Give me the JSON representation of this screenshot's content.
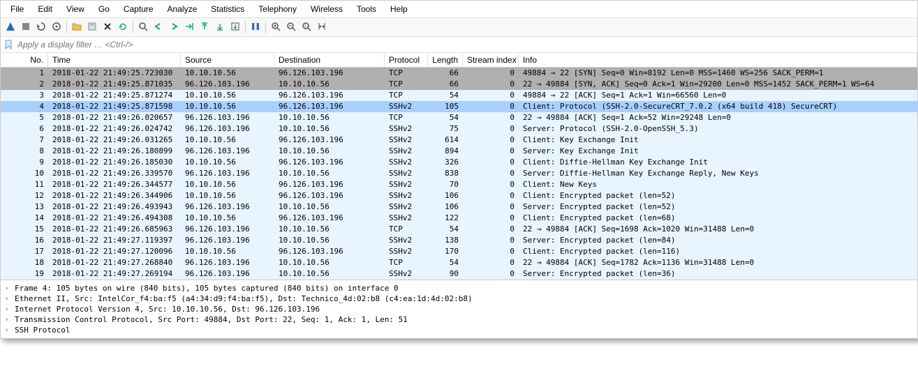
{
  "menubar": [
    "File",
    "Edit",
    "View",
    "Go",
    "Capture",
    "Analyze",
    "Statistics",
    "Telephony",
    "Wireless",
    "Tools",
    "Help"
  ],
  "filter": {
    "placeholder": "Apply a display filter … <Ctrl-/>"
  },
  "columns": [
    "No.",
    "Time",
    "Source",
    "Destination",
    "Protocol",
    "Length",
    "Stream index",
    "Info"
  ],
  "packets": [
    {
      "no": "1",
      "time": "2018-01-22 21:49:25.723030",
      "src": "10.10.10.56",
      "dst": "96.126.103.196",
      "proto": "TCP",
      "len": "66",
      "stream": "0",
      "info": "49884 → 22 [SYN] Seq=0 Win=8192 Len=0 MSS=1460 WS=256 SACK_PERM=1",
      "cls": "row-bg-gray"
    },
    {
      "no": "2",
      "time": "2018-01-22 21:49:25.871035",
      "src": "96.126.103.196",
      "dst": "10.10.10.56",
      "proto": "TCP",
      "len": "66",
      "stream": "0",
      "info": "22 → 49884 [SYN, ACK] Seq=0 Ack=1 Win=29200 Len=0 MSS=1452 SACK_PERM=1 WS=64",
      "cls": "row-bg-gray"
    },
    {
      "no": "3",
      "time": "2018-01-22 21:49:25.871274",
      "src": "10.10.10.56",
      "dst": "96.126.103.196",
      "proto": "TCP",
      "len": "54",
      "stream": "0",
      "info": "49884 → 22 [ACK] Seq=1 Ack=1 Win=66560 Len=0",
      "cls": "row-bg-lightblue"
    },
    {
      "no": "4",
      "time": "2018-01-22 21:49:25.871598",
      "src": "10.10.10.56",
      "dst": "96.126.103.196",
      "proto": "SSHv2",
      "len": "105",
      "stream": "0",
      "info": "Client: Protocol (SSH-2.0-SecureCRT_7.0.2 (x64 build 418) SecureCRT)",
      "cls": "row-selected"
    },
    {
      "no": "5",
      "time": "2018-01-22 21:49:26.020657",
      "src": "96.126.103.196",
      "dst": "10.10.10.56",
      "proto": "TCP",
      "len": "54",
      "stream": "0",
      "info": "22 → 49884 [ACK] Seq=1 Ack=52 Win=29248 Len=0",
      "cls": "row-bg-lightblue"
    },
    {
      "no": "6",
      "time": "2018-01-22 21:49:26.024742",
      "src": "96.126.103.196",
      "dst": "10.10.10.56",
      "proto": "SSHv2",
      "len": "75",
      "stream": "0",
      "info": "Server: Protocol (SSH-2.0-OpenSSH_5.3)",
      "cls": "row-bg-lightblue"
    },
    {
      "no": "7",
      "time": "2018-01-22 21:49:26.031265",
      "src": "10.10.10.56",
      "dst": "96.126.103.196",
      "proto": "SSHv2",
      "len": "614",
      "stream": "0",
      "info": "Client: Key Exchange Init",
      "cls": "row-bg-lightblue"
    },
    {
      "no": "8",
      "time": "2018-01-22 21:49:26.180899",
      "src": "96.126.103.196",
      "dst": "10.10.10.56",
      "proto": "SSHv2",
      "len": "894",
      "stream": "0",
      "info": "Server: Key Exchange Init",
      "cls": "row-bg-lightblue"
    },
    {
      "no": "9",
      "time": "2018-01-22 21:49:26.185030",
      "src": "10.10.10.56",
      "dst": "96.126.103.196",
      "proto": "SSHv2",
      "len": "326",
      "stream": "0",
      "info": "Client: Diffie-Hellman Key Exchange Init",
      "cls": "row-bg-lightblue"
    },
    {
      "no": "10",
      "time": "2018-01-22 21:49:26.339570",
      "src": "96.126.103.196",
      "dst": "10.10.10.56",
      "proto": "SSHv2",
      "len": "838",
      "stream": "0",
      "info": "Server: Diffie-Hellman Key Exchange Reply, New Keys",
      "cls": "row-bg-lightblue"
    },
    {
      "no": "11",
      "time": "2018-01-22 21:49:26.344577",
      "src": "10.10.10.56",
      "dst": "96.126.103.196",
      "proto": "SSHv2",
      "len": "70",
      "stream": "0",
      "info": "Client: New Keys",
      "cls": "row-bg-lightblue"
    },
    {
      "no": "12",
      "time": "2018-01-22 21:49:26.344906",
      "src": "10.10.10.56",
      "dst": "96.126.103.196",
      "proto": "SSHv2",
      "len": "106",
      "stream": "0",
      "info": "Client: Encrypted packet (len=52)",
      "cls": "row-bg-lightblue"
    },
    {
      "no": "13",
      "time": "2018-01-22 21:49:26.493943",
      "src": "96.126.103.196",
      "dst": "10.10.10.56",
      "proto": "SSHv2",
      "len": "106",
      "stream": "0",
      "info": "Server: Encrypted packet (len=52)",
      "cls": "row-bg-lightblue"
    },
    {
      "no": "14",
      "time": "2018-01-22 21:49:26.494308",
      "src": "10.10.10.56",
      "dst": "96.126.103.196",
      "proto": "SSHv2",
      "len": "122",
      "stream": "0",
      "info": "Client: Encrypted packet (len=68)",
      "cls": "row-bg-lightblue"
    },
    {
      "no": "15",
      "time": "2018-01-22 21:49:26.685963",
      "src": "96.126.103.196",
      "dst": "10.10.10.56",
      "proto": "TCP",
      "len": "54",
      "stream": "0",
      "info": "22 → 49884 [ACK] Seq=1698 Ack=1020 Win=31488 Len=0",
      "cls": "row-bg-lightblue"
    },
    {
      "no": "16",
      "time": "2018-01-22 21:49:27.119397",
      "src": "96.126.103.196",
      "dst": "10.10.10.56",
      "proto": "SSHv2",
      "len": "138",
      "stream": "0",
      "info": "Server: Encrypted packet (len=84)",
      "cls": "row-bg-lightblue"
    },
    {
      "no": "17",
      "time": "2018-01-22 21:49:27.120096",
      "src": "10.10.10.56",
      "dst": "96.126.103.196",
      "proto": "SSHv2",
      "len": "170",
      "stream": "0",
      "info": "Client: Encrypted packet (len=116)",
      "cls": "row-bg-lightblue"
    },
    {
      "no": "18",
      "time": "2018-01-22 21:49:27.268840",
      "src": "96.126.103.196",
      "dst": "10.10.10.56",
      "proto": "TCP",
      "len": "54",
      "stream": "0",
      "info": "22 → 49884 [ACK] Seq=1782 Ack=1136 Win=31488 Len=0",
      "cls": "row-bg-lightblue"
    },
    {
      "no": "19",
      "time": "2018-01-22 21:49:27.269194",
      "src": "96.126.103.196",
      "dst": "10.10.10.56",
      "proto": "SSHv2",
      "len": "90",
      "stream": "0",
      "info": "Server: Encrypted packet (len=36)",
      "cls": "row-bg-lightblue"
    }
  ],
  "details": [
    "Frame 4: 105 bytes on wire (840 bits), 105 bytes captured (840 bits) on interface 0",
    "Ethernet II, Src: IntelCor_f4:ba:f5 (a4:34:d9:f4:ba:f5), Dst: Technico_4d:02:b8 (c4:ea:1d:4d:02:b8)",
    "Internet Protocol Version 4, Src: 10.10.10.56, Dst: 96.126.103.196",
    "Transmission Control Protocol, Src Port: 49884, Dst Port: 22, Seq: 1, Ack: 1, Len: 51",
    "SSH Protocol"
  ],
  "toolbar_icons": [
    {
      "name": "shark-fin-icon",
      "svg": "<svg width='16' height='16' viewBox='0 0 16 16'><path d='M2 14 L8 2 L12 10 L14 14 Z' fill='#1e6db5'/></svg>"
    },
    {
      "name": "stop-icon",
      "svg": "<svg width='16' height='16' viewBox='0 0 16 16'><rect x='3' y='3' width='10' height='10' fill='#888'/></svg>"
    },
    {
      "name": "restart-icon",
      "svg": "<svg width='16' height='16' viewBox='0 0 16 16'><path d='M8 3 a5 5 0 1 1 -5 5' fill='none' stroke='#555' stroke-width='1.5'/><path d='M3 5 L3 8 L6 8' fill='none' stroke='#555' stroke-width='1.5'/></svg>"
    },
    {
      "name": "options-icon",
      "svg": "<svg width='16' height='16' viewBox='0 0 16 16'><circle cx='8' cy='8' r='5' fill='none' stroke='#555' stroke-width='1.5'/><circle cx='8' cy='8' r='1.5' fill='#555'/></svg>"
    },
    {
      "name": "open-icon",
      "svg": "<svg width='16' height='16' viewBox='0 0 16 16'><path d='M2 4 L6 4 L7 6 L14 6 L14 13 L2 13 Z' fill='#f3c557' stroke='#b88a2a'/></svg>"
    },
    {
      "name": "save-icon",
      "svg": "<svg width='16' height='16' viewBox='0 0 16 16'><rect x='3' y='3' width='10' height='10' fill='#ddd' stroke='#888'/><rect x='5' y='3' width='6' height='4' fill='#a7c7e7'/></svg>"
    },
    {
      "name": "close-icon",
      "svg": "<svg width='16' height='16' viewBox='0 0 16 16'><path d='M4 4 L12 12 M12 4 L4 12' stroke='#333' stroke-width='2'/></svg>"
    },
    {
      "name": "reload-icon",
      "svg": "<svg width='16' height='16' viewBox='0 0 16 16'><path d='M4 8 a4 4 0 1 1 1 3' fill='none' stroke='#2a7' stroke-width='1.5'/><path d='M4 11 L4 8 L7 8' fill='none' stroke='#2a7' stroke-width='1.5'/></svg>"
    },
    {
      "name": "find-icon",
      "svg": "<svg width='16' height='16' viewBox='0 0 16 16'><circle cx='7' cy='7' r='4' fill='none' stroke='#555' stroke-width='1.5'/><line x1='10' y1='10' x2='14' y2='14' stroke='#555' stroke-width='1.5'/></svg>"
    },
    {
      "name": "prev-icon",
      "svg": "<svg width='16' height='16' viewBox='0 0 16 16'><path d='M10 4 L4 8 L10 12' fill='none' stroke='#2a7' stroke-width='2'/></svg>"
    },
    {
      "name": "next-icon",
      "svg": "<svg width='16' height='16' viewBox='0 0 16 16'><path d='M6 4 L12 8 L6 12' fill='none' stroke='#2a7' stroke-width='2'/></svg>"
    },
    {
      "name": "goto-icon",
      "svg": "<svg width='16' height='16' viewBox='0 0 16 16'><path d='M3 8 L11 8 M8 5 L11 8 L8 11' fill='none' stroke='#2a7' stroke-width='1.5'/><line x1='13' y1='3' x2='13' y2='13' stroke='#2a7' stroke-width='1.5'/></svg>"
    },
    {
      "name": "go-first-icon",
      "svg": "<svg width='16' height='16' viewBox='0 0 16 16'><path d='M8 12 L8 4 M5 7 L8 4 L11 7' fill='none' stroke='#2a7' stroke-width='1.5'/><line x1='4' y1='3' x2='12' y2='3' stroke='#2a7' stroke-width='1.5'/></svg>"
    },
    {
      "name": "go-last-icon",
      "svg": "<svg width='16' height='16' viewBox='0 0 16 16'><path d='M8 4 L8 12 M5 9 L8 12 L11 9' fill='none' stroke='#2a7' stroke-width='1.5'/><line x1='4' y1='13' x2='12' y2='13' stroke='#2a7' stroke-width='1.5'/></svg>"
    },
    {
      "name": "auto-scroll-icon",
      "svg": "<svg width='16' height='16' viewBox='0 0 16 16'><rect x='3' y='3' width='10' height='10' fill='none' stroke='#555'/><path d='M8 5 L8 11 M6 9 L8 11 L10 9' fill='none' stroke='#2a7' stroke-width='1.5'/></svg>"
    },
    {
      "name": "colorize-icon",
      "svg": "<svg width='16' height='16' viewBox='0 0 16 16'><rect x='3' y='3' width='3' height='10' fill='#36c'/><rect x='6.5' y='3' width='3' height='10' fill='#fff' stroke='#ccc'/><rect x='10' y='3' width='3' height='10' fill='#36c'/></svg>"
    },
    {
      "name": "zoom-in-icon",
      "svg": "<svg width='16' height='16' viewBox='0 0 16 16'><circle cx='7' cy='7' r='4' fill='none' stroke='#555' stroke-width='1.5'/><line x1='10' y1='10' x2='14' y2='14' stroke='#555' stroke-width='1.5'/><line x1='5' y1='7' x2='9' y2='7' stroke='#555'/><line x1='7' y1='5' x2='7' y2='9' stroke='#555'/></svg>"
    },
    {
      "name": "zoom-out-icon",
      "svg": "<svg width='16' height='16' viewBox='0 0 16 16'><circle cx='7' cy='7' r='4' fill='none' stroke='#555' stroke-width='1.5'/><line x1='10' y1='10' x2='14' y2='14' stroke='#555' stroke-width='1.5'/><line x1='5' y1='7' x2='9' y2='7' stroke='#555'/></svg>"
    },
    {
      "name": "zoom-fit-icon",
      "svg": "<svg width='16' height='16' viewBox='0 0 16 16'><circle cx='7' cy='7' r='4' fill='none' stroke='#555' stroke-width='1.5'/><line x1='10' y1='10' x2='14' y2='14' stroke='#555' stroke-width='1.5'/><text x='4.5' y='9' font-size='5' fill='#555'>1:1</text></svg>"
    },
    {
      "name": "resize-cols-icon",
      "svg": "<svg width='16' height='16' viewBox='0 0 16 16'><line x1='4' y1='3' x2='4' y2='13' stroke='#555'/><line x1='12' y1='3' x2='12' y2='13' stroke='#555'/><path d='M5 8 L11 8 M6 6 L5 8 L6 10 M10 6 L11 8 L10 10' fill='none' stroke='#555'/></svg>"
    }
  ],
  "toolbar_layout": [
    0,
    1,
    2,
    3,
    "sep",
    4,
    5,
    6,
    7,
    "sep",
    8,
    9,
    10,
    11,
    12,
    13,
    14,
    "sep",
    15,
    "sep",
    16,
    17,
    18,
    19
  ],
  "tree_glyph": "›"
}
